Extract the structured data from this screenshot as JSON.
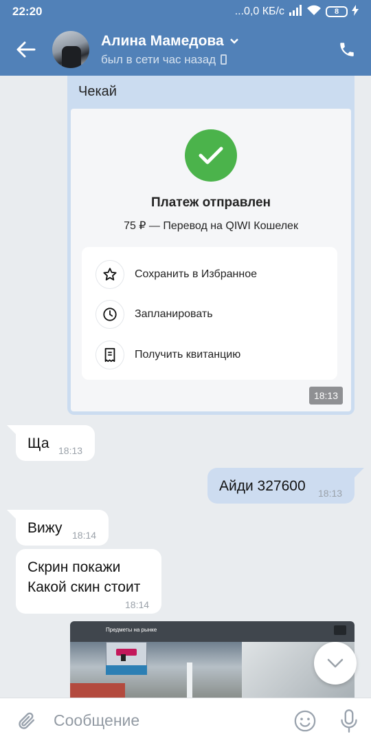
{
  "status_bar": {
    "time": "22:20",
    "network_speed": "...0,0 КБ/с",
    "battery_level": "8"
  },
  "header": {
    "contact_name": "Алина Мамедова",
    "contact_status": "был в сети час назад",
    "icons": [
      "back-arrow-icon",
      "chevron-down-icon",
      "mobile-device-icon",
      "phone-icon"
    ]
  },
  "payment_message": {
    "caption": "Чекай",
    "title": "Платеж отправлен",
    "subtitle": "75 ₽ — Перевод на QIWI Кошелек",
    "actions": [
      {
        "label": "Сохранить в Избранное",
        "icon": "star-icon"
      },
      {
        "label": "Запланировать",
        "icon": "clock-icon"
      },
      {
        "label": "Получить квитанцию",
        "icon": "receipt-icon"
      }
    ],
    "time": "18:13",
    "success_color": "#4bb34b"
  },
  "messages": [
    {
      "direction": "in",
      "text": "Ща",
      "time": "18:13"
    },
    {
      "direction": "out",
      "text": "Айди 327600",
      "time": "18:13"
    },
    {
      "direction": "in",
      "text": "Вижу",
      "time": "18:14"
    },
    {
      "direction": "in",
      "lines": [
        "Скрин покажи",
        "Какой скин стоит"
      ],
      "time": "18:14"
    }
  ],
  "image_message": {
    "header_text": "Предметы на рынке"
  },
  "composer": {
    "placeholder": "Сообщение"
  },
  "colors": {
    "header_bg": "#5181b8",
    "chat_bg": "#e9ecef",
    "outgoing_bubble": "#cddcf0",
    "incoming_bubble": "#ffffff"
  }
}
